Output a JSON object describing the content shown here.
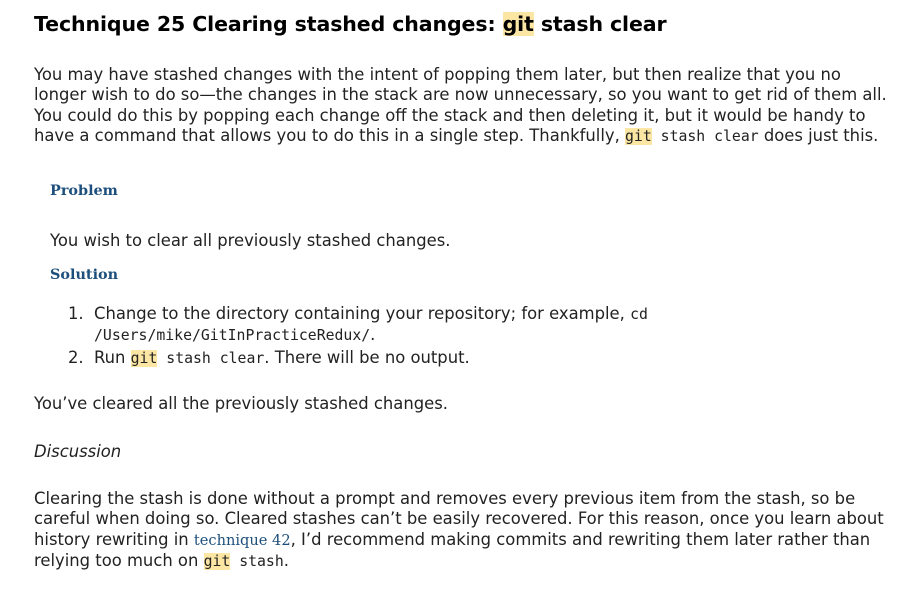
{
  "title": {
    "prefix": "Technique 25 Clearing stashed changes: ",
    "code": "git",
    "suffix": " stash clear"
  },
  "intro": {
    "text": "You may have stashed changes with the intent of popping them later, but then realize that you no longer wish to do so—the changes in the stack are now unnecessary, so you want to get rid of them all. You could do this by popping each change off the stack and then deleting it, but it would be handy to have a command that allows you to do this in a single step. Thankfully, ",
    "code_hl": "git",
    "code_rest": " stash clear",
    "tail": " does just this."
  },
  "problem": {
    "heading": "Problem",
    "text": "You wish to clear all previously stashed changes."
  },
  "solution": {
    "heading": "Solution",
    "steps": [
      {
        "num": "1.",
        "text": "Change to the directory containing your repository; for example, ",
        "code": "cd /Users/mike/GitInPracticeRedux/",
        "tail": "."
      },
      {
        "num": "2.",
        "text": "Run ",
        "code_hl": "git",
        "code_rest": " stash clear",
        "tail": ". There will be no output."
      }
    ]
  },
  "result": "You’ve cleared all the previously stashed changes.",
  "discussion": {
    "heading": "Discussion",
    "text": "Clearing the stash is done without a prompt and removes every previous item from the stash, so be careful when doing so. Cleared stashes can’t be easily recovered. For this reason, once you learn about history rewriting in ",
    "link": "technique 42",
    "text2": ", I’d recommend making commits and rewriting them later rather than relying too much on ",
    "code_hl": "git",
    "code_rest": " stash",
    "tail": "."
  },
  "colors": {
    "code_highlight": "#fce6a4",
    "heading_blue": "#1d4f7c",
    "text": "#222222"
  }
}
